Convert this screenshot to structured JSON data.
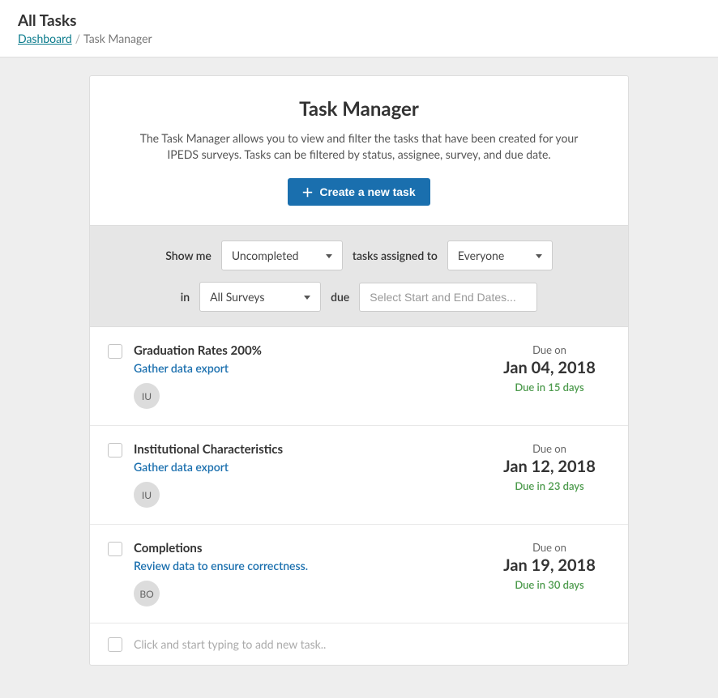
{
  "header": {
    "title": "All Tasks",
    "breadcrumb_link": "Dashboard",
    "breadcrumb_current": "Task Manager"
  },
  "intro": {
    "heading": "Task Manager",
    "description": "The Task Manager allows you to view and filter the tasks that have been created for your IPEDS surveys. Tasks can be filtered by status, assignee, survey, and due date.",
    "create_button": "Create a new task"
  },
  "filters": {
    "label_show_me": "Show me",
    "status_selected": "Uncompleted",
    "label_assigned_to": "tasks assigned to",
    "assignee_selected": "Everyone",
    "label_in": "in",
    "survey_selected": "All Surveys",
    "label_due": "due",
    "date_placeholder": "Select Start and End Dates..."
  },
  "tasks": [
    {
      "category": "Graduation Rates 200%",
      "title": "Gather data export",
      "avatar": "IU",
      "due_label": "Due on",
      "due_date": "Jan 04, 2018",
      "due_remaining": "Due in 15 days"
    },
    {
      "category": "Institutional Characteristics",
      "title": "Gather data export",
      "avatar": "IU",
      "due_label": "Due on",
      "due_date": "Jan 12, 2018",
      "due_remaining": "Due in 23 days"
    },
    {
      "category": "Completions",
      "title": "Review data to ensure correctness.",
      "avatar": "BO",
      "due_label": "Due on",
      "due_date": "Jan 19, 2018",
      "due_remaining": "Due in 30 days"
    }
  ],
  "add_row": {
    "placeholder": "Click and start typing to add new task.."
  }
}
